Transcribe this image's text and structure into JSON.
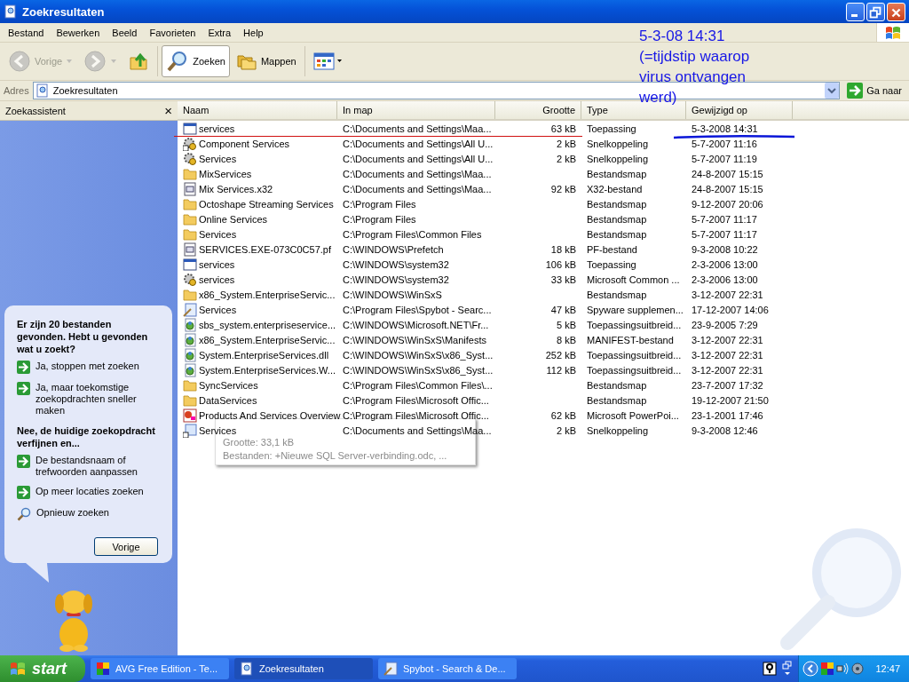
{
  "window": {
    "title": "Zoekresultaten"
  },
  "menu": [
    "Bestand",
    "Bewerken",
    "Beeld",
    "Favorieten",
    "Extra",
    "Help"
  ],
  "toolbar": [
    {
      "kind": "back",
      "label": "Vorige",
      "disabled": true,
      "selected": false
    },
    {
      "kind": "forward",
      "disabled": true,
      "selected": false
    },
    {
      "kind": "up",
      "disabled": false,
      "selected": false
    },
    {
      "kind": "search",
      "label": "Zoeken",
      "disabled": false,
      "selected": true
    },
    {
      "kind": "folders",
      "label": "Mappen",
      "disabled": false,
      "selected": false
    },
    {
      "kind": "views",
      "disabled": false,
      "selected": false
    }
  ],
  "address": {
    "label": "Adres",
    "value": "Zoekresultaten",
    "go": "Ga naar"
  },
  "sidebar": {
    "title": "Zoekassistent",
    "close": "×",
    "button": "Vorige",
    "items": [
      {
        "kind": "heading",
        "label": "Er zijn 20 bestanden gevonden. Hebt u gevonden wat u zoekt?"
      },
      {
        "kind": "arrow",
        "label": "Ja, stoppen met zoeken"
      },
      {
        "kind": "arrow",
        "label": "Ja, maar toekomstige zoekopdrachten sneller maken"
      },
      {
        "kind": "heading",
        "label": "Nee, de huidige zoekopdracht verfijnen en..."
      },
      {
        "kind": "arrow",
        "label": "De bestandsnaam of trefwoorden aanpassen"
      },
      {
        "kind": "arrow",
        "label": "Op meer locaties zoeken"
      },
      {
        "kind": "search",
        "label": "Opnieuw zoeken"
      }
    ]
  },
  "table": {
    "columns": [
      "Naam",
      "In map",
      "Grootte",
      "Type",
      "Gewijzigd op"
    ],
    "rows": [
      {
        "kind": "app",
        "name": "services",
        "folder": "C:\\Documents and Settings\\Maa...",
        "size": "63 kB",
        "type": "Toepassing",
        "modified": "5-3-2008 14:31",
        "marked": true
      },
      {
        "kind": "shortcut-gear",
        "name": "Component Services",
        "folder": "C:\\Documents and Settings\\All U...",
        "size": "2 kB",
        "type": "Snelkoppeling",
        "modified": "5-7-2007 11:16"
      },
      {
        "kind": "gear",
        "name": "Services",
        "folder": "C:\\Documents and Settings\\All U...",
        "size": "2 kB",
        "type": "Snelkoppeling",
        "modified": "5-7-2007 11:19"
      },
      {
        "kind": "folder",
        "name": "MixServices",
        "folder": "C:\\Documents and Settings\\Maa...",
        "type": "Bestandsmap",
        "modified": "24-8-2007 15:15"
      },
      {
        "kind": "file",
        "name": "Mix Services.x32",
        "folder": "C:\\Documents and Settings\\Maa...",
        "size": "92 kB",
        "type": "X32-bestand",
        "modified": "24-8-2007 15:15"
      },
      {
        "kind": "folder",
        "name": "Octoshape Streaming Services",
        "folder": "C:\\Program Files",
        "type": "Bestandsmap",
        "modified": "9-12-2007 20:06"
      },
      {
        "kind": "folder",
        "name": "Online Services",
        "folder": "C:\\Program Files",
        "type": "Bestandsmap",
        "modified": "5-7-2007 11:17"
      },
      {
        "kind": "folder",
        "name": "Services",
        "folder": "C:\\Program Files\\Common Files",
        "type": "Bestandsmap",
        "modified": "5-7-2007 11:17"
      },
      {
        "kind": "file",
        "name": "SERVICES.EXE-073C0C57.pf",
        "folder": "C:\\WINDOWS\\Prefetch",
        "size": "18 kB",
        "type": "PF-bestand",
        "modified": "9-3-2008 10:22"
      },
      {
        "kind": "app",
        "name": "services",
        "folder": "C:\\WINDOWS\\system32",
        "size": "106 kB",
        "type": "Toepassing",
        "modified": "2-3-2006 13:00"
      },
      {
        "kind": "gear",
        "name": "services",
        "folder": "C:\\WINDOWS\\system32",
        "size": "33 kB",
        "type": "Microsoft Common ...",
        "modified": "2-3-2006 13:00"
      },
      {
        "kind": "folder",
        "name": "x86_System.EnterpriseServic...",
        "folder": "C:\\WINDOWS\\WinSxS",
        "type": "Bestandsmap",
        "modified": "3-12-2007 22:31"
      },
      {
        "kind": "spybot",
        "name": "Services",
        "folder": "C:\\Program Files\\Spybot - Searc...",
        "size": "47 kB",
        "type": "Spyware supplemen...",
        "modified": "17-12-2007 14:06"
      },
      {
        "kind": "dll",
        "name": "sbs_system.enterpriseservice...",
        "folder": "C:\\WINDOWS\\Microsoft.NET\\Fr...",
        "size": "5 kB",
        "type": "Toepassingsuitbreid...",
        "modified": "23-9-2005 7:29"
      },
      {
        "kind": "dll",
        "name": "x86_System.EnterpriseServic...",
        "folder": "C:\\WINDOWS\\WinSxS\\Manifests",
        "size": "8 kB",
        "type": "MANIFEST-bestand",
        "modified": "3-12-2007 22:31"
      },
      {
        "kind": "dll",
        "name": "System.EnterpriseServices.dll",
        "folder": "C:\\WINDOWS\\WinSxS\\x86_Syst...",
        "size": "252 kB",
        "type": "Toepassingsuitbreid...",
        "modified": "3-12-2007 22:31"
      },
      {
        "kind": "dll",
        "name": "System.EnterpriseServices.W...",
        "folder": "C:\\WINDOWS\\WinSxS\\x86_Syst...",
        "size": "112 kB",
        "type": "Toepassingsuitbreid...",
        "modified": "3-12-2007 22:31"
      },
      {
        "kind": "folder",
        "name": "SyncServices",
        "folder": "C:\\Program Files\\Common Files\\...",
        "type": "Bestandsmap",
        "modified": "23-7-2007 17:32"
      },
      {
        "kind": "folder",
        "name": "DataServices",
        "folder": "C:\\Program Files\\Microsoft Offic...",
        "type": "Bestandsmap",
        "modified": "19-12-2007 21:50"
      },
      {
        "kind": "ppt",
        "name": "Products And Services Overview",
        "folder": "C:\\Program Files\\Microsoft Offic...",
        "size": "62 kB",
        "type": "Microsoft PowerPoi...",
        "modified": "23-1-2001 17:46"
      },
      {
        "kind": "shortcut",
        "name": "Services",
        "folder": "C:\\Documents and Settings\\Maa...",
        "size": "2 kB",
        "type": "Snelkoppeling",
        "modified": "9-3-2008 12:46"
      }
    ]
  },
  "tooltip": {
    "lines": [
      "Grootte: 33,1 kB",
      "Bestanden: +Nieuwe SQL Server-verbinding.odc, ..."
    ]
  },
  "annotation": {
    "lines": [
      "5-3-08 14:31",
      "(=tijdstip waarop",
      "virus ontvangen",
      "werd)"
    ]
  },
  "taskbar": {
    "start": "start",
    "tasks": [
      {
        "kind": "avg",
        "label": "AVG Free Edition - Te...",
        "selected": false
      },
      {
        "kind": "search",
        "label": "Zoekresultaten",
        "selected": true
      },
      {
        "kind": "spybot",
        "label": "Spybot - Search & De...",
        "selected": false
      }
    ],
    "clock": "12:47"
  }
}
